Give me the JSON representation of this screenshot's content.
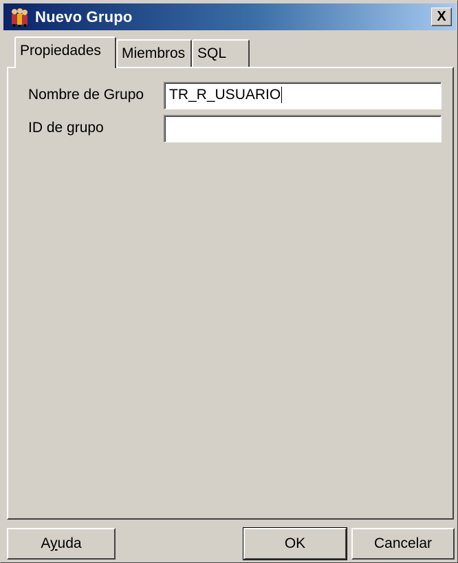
{
  "window": {
    "title": "Nuevo Grupo",
    "icon": "group-users-icon",
    "close_label": "X"
  },
  "tabs": [
    {
      "label": "Propiedades",
      "active": true
    },
    {
      "label": "Miembros",
      "active": false
    },
    {
      "label": "SQL",
      "active": false
    }
  ],
  "form": {
    "group_name": {
      "label": "Nombre de Grupo",
      "value": "TR_R_USUARIO"
    },
    "group_id": {
      "label": "ID de grupo",
      "value": ""
    }
  },
  "buttons": {
    "help_prefix": "A",
    "help_mnemonic": "y",
    "help_suffix": "uda",
    "ok": "OK",
    "cancel": "Cancelar"
  },
  "colors": {
    "face": "#d4d0c8",
    "title_gradient_start": "#0a246a",
    "title_gradient_end": "#a6caf0"
  }
}
